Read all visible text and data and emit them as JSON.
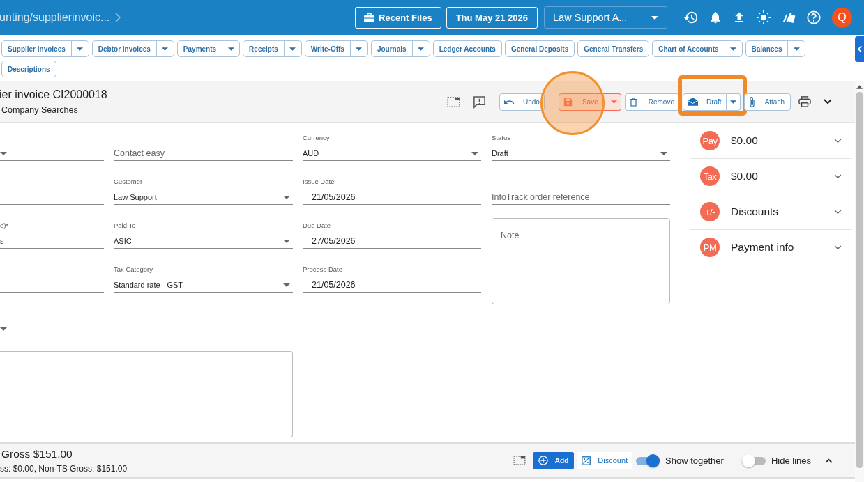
{
  "header": {
    "breadcrumb": "unting/supplierinvoic...",
    "recent_files": "Recent Files",
    "date": "Thu May 21 2026",
    "company": "Law Support A...",
    "avatar": "Q"
  },
  "nav_tabs": [
    {
      "label": "Supplier Invoices",
      "kind": "split"
    },
    {
      "label": "Debtor Invoices",
      "kind": "split"
    },
    {
      "label": "Payments",
      "kind": "split"
    },
    {
      "label": "Receipts",
      "kind": "split"
    },
    {
      "label": "Write-Offs",
      "kind": "split"
    },
    {
      "label": "Journals",
      "kind": "split"
    },
    {
      "label": "Ledger Accounts",
      "kind": "plain"
    },
    {
      "label": "General Deposits",
      "kind": "plain"
    },
    {
      "label": "General Transfers",
      "kind": "plain"
    },
    {
      "label": "Chart of Accounts",
      "kind": "split"
    },
    {
      "label": "Balances",
      "kind": "split"
    },
    {
      "label": "Descriptions",
      "kind": "plain"
    }
  ],
  "invoice": {
    "title": "ier invoice CI2000018",
    "subtitle": "Company Searches"
  },
  "actions": [
    {
      "label": "Undo",
      "kind": "undo"
    },
    {
      "label": "Save",
      "kind": "save",
      "highlight": {
        "kind": "circle"
      }
    },
    {
      "label": "Remove",
      "kind": "remove"
    },
    {
      "label": "Draft",
      "kind": "draft",
      "highlight": {
        "kind": "frame"
      }
    },
    {
      "label": "Attach",
      "kind": "attach"
    }
  ],
  "columns": [
    [
      {
        "kind": "select"
      },
      {
        "kind": "text"
      },
      {
        "kind": "text",
        "label": "e)*",
        "value": "s"
      },
      {
        "kind": "text"
      },
      {
        "kind": "select"
      }
    ],
    [
      {
        "kind": "text",
        "placeholder": "Contact easy"
      },
      {
        "kind": "select",
        "label": "Customer",
        "value": "Law Support"
      },
      {
        "kind": "select",
        "label": "Paid To",
        "value": "ASIC"
      },
      {
        "kind": "select",
        "label": "Tax Category",
        "value": "Standard rate - GST"
      }
    ],
    [
      {
        "kind": "select",
        "label": "Currency",
        "value": "AUD"
      },
      {
        "kind": "date",
        "label": "Issue Date",
        "value": "21/05/2026"
      },
      {
        "kind": "date",
        "label": "Due Date",
        "value": "27/05/2026"
      },
      {
        "kind": "date",
        "label": "Process Date",
        "value": "21/05/2026"
      }
    ],
    [
      {
        "kind": "select",
        "label": "Status",
        "value": "Draft"
      },
      {
        "kind": "text",
        "placeholder": "InfoTrack order reference"
      },
      {
        "kind": "textarea",
        "placeholder": "Note"
      }
    ]
  ],
  "summary": [
    {
      "badge": "Pay",
      "text": "$0.00"
    },
    {
      "badge": "Tax",
      "text": "$0.00"
    },
    {
      "badge": "+/-",
      "text": "Discounts"
    },
    {
      "badge": "PM",
      "text": "Payment info"
    }
  ],
  "footer": {
    "gross": "Gross $151.00",
    "detail": "ss: $0.00, Non-TS Gross: $151.00",
    "add": "Add",
    "discount": "Discount",
    "toggles": [
      {
        "label": "Show together",
        "on": true
      },
      {
        "label": "Hide lines",
        "on": false
      }
    ]
  }
}
